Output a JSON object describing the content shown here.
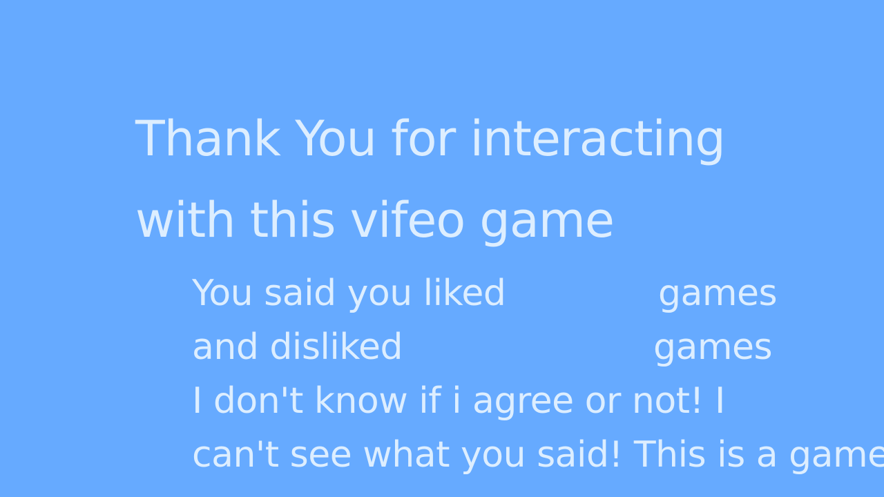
{
  "screen": {
    "background_color": "#66aaff",
    "text_color": "#ddeeff",
    "title_lines": [
      "Thank You for interacting",
      "with this vifeo game"
    ],
    "message": {
      "liked_text": "You said you liked",
      "liked_suffix": "games",
      "disliked_text": "and disliked",
      "disliked_suffix": "games",
      "line_3": "I don't know if i agree or not! I",
      "line_4": "can't see what you said! This is a game"
    }
  }
}
